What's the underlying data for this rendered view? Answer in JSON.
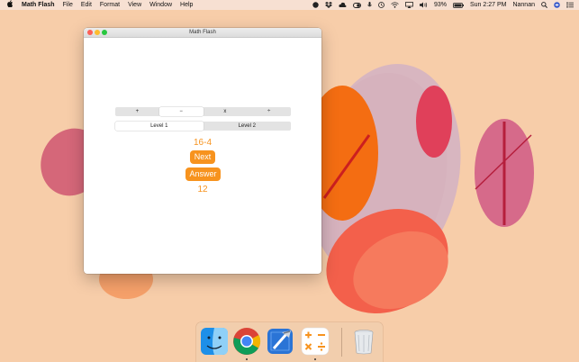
{
  "menubar": {
    "apple_icon": "apple-logo",
    "app_name": "Math Flash",
    "menus": [
      "File",
      "Edit",
      "Format",
      "View",
      "Window",
      "Help"
    ],
    "battery_percent": "93%",
    "clock": "Sun 2:27 PM",
    "user": "Nannan"
  },
  "window": {
    "title": "Math Flash",
    "operations": [
      "+",
      "−",
      "x",
      "÷"
    ],
    "selected_operation": "−",
    "levels": [
      "Level 1",
      "Level 2"
    ],
    "selected_level": "Level 1",
    "problem": "16-4",
    "next_label": "Next",
    "answer_label": "Answer",
    "answer": "12",
    "accent_color": "#f7931e"
  },
  "dock": {
    "apps": [
      "Finder",
      "Google Chrome",
      "Xcode",
      "Calculator",
      "Trash"
    ]
  }
}
